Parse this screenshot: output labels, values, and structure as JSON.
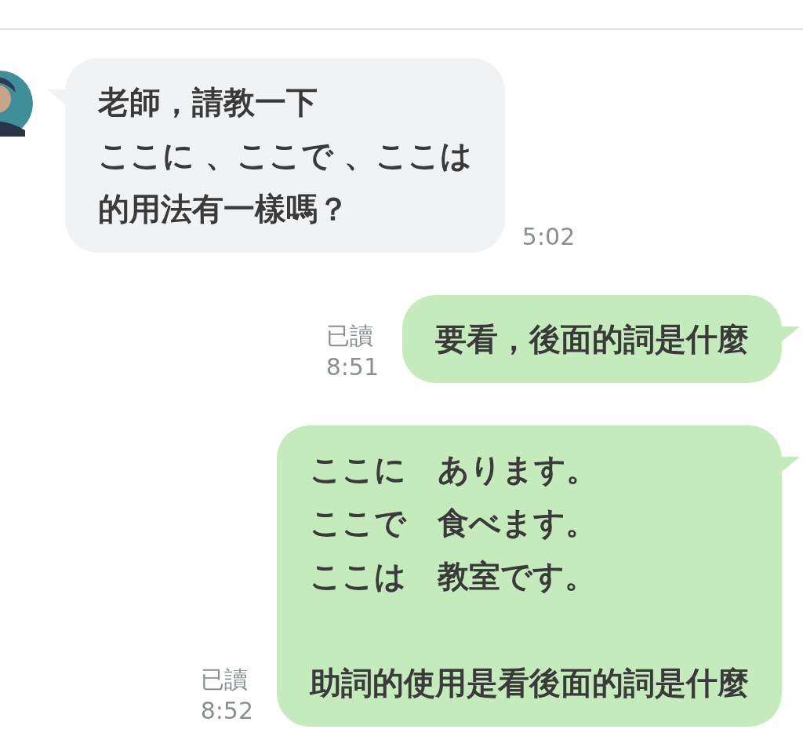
{
  "messages": [
    {
      "kind": "incoming",
      "paragraphs": [
        [
          "老師，請教一下",
          "ここに 、ここで 、ここは",
          "的用法有一樣嗎？"
        ]
      ],
      "time": "5:02"
    },
    {
      "kind": "outgoing",
      "read": "已讀",
      "time": "8:51",
      "paragraphs": [
        [
          "要看，後面的詞是什麼"
        ]
      ]
    },
    {
      "kind": "outgoing",
      "read": "已讀",
      "time": "8:52",
      "paragraphs": [
        [
          "ここに　あります。",
          "ここで　食べます。",
          "ここは　教室です。"
        ],
        [
          "助詞的使用是看後面的詞是什麼"
        ]
      ]
    }
  ]
}
